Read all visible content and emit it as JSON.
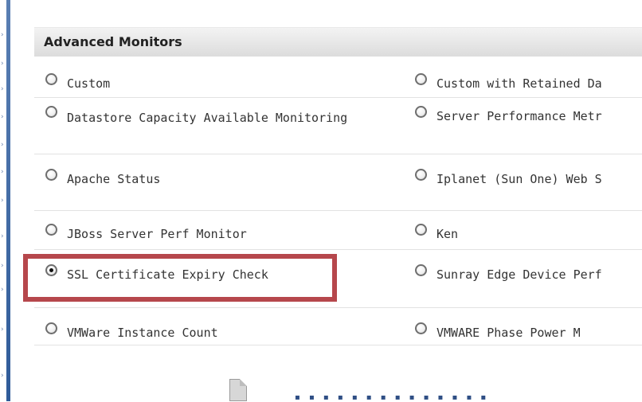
{
  "panel": {
    "title": "Advanced Monitors"
  },
  "options": [
    {
      "left": "Custom",
      "right": "Custom with Retained Da",
      "left_checked": false,
      "right_checked": false
    },
    {
      "left": "Datastore Capacity Available Monitoring",
      "right": "Server Performance Metr",
      "left_checked": false,
      "right_checked": false
    },
    {
      "left": "Apache Status",
      "right": "Iplanet (Sun One) Web S",
      "left_checked": false,
      "right_checked": false
    },
    {
      "left": "JBoss Server Perf Monitor",
      "right": "Ken",
      "left_checked": false,
      "right_checked": false
    },
    {
      "left": "SSL Certificate Expiry Check",
      "right": "Sunray Edge Device Perf",
      "left_checked": true,
      "right_checked": false
    },
    {
      "left": "VMWare Instance Count",
      "right": "VMWARE Phase Power M",
      "left_checked": false,
      "right_checked": false
    }
  ],
  "colors": {
    "highlight": "#b6474c",
    "header_bg": "#dcdcdc",
    "left_rail": "#2f5b99"
  }
}
